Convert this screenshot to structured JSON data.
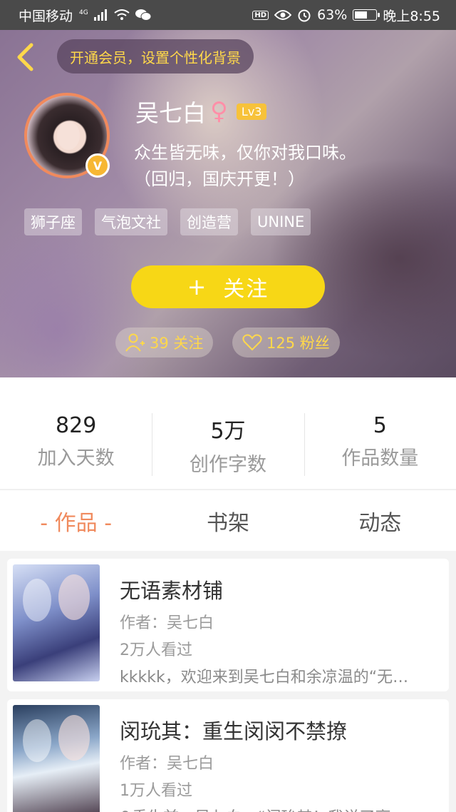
{
  "status_bar": {
    "carrier": "中国移动",
    "network": "4G",
    "battery": "63%",
    "battery_level": 0.63,
    "time": "晚上8:55"
  },
  "header": {
    "vip_prompt": "开通会员，设置个性化背景",
    "name": "吴七白",
    "gender_symbol": "♀",
    "level": "Lv3",
    "verified_badge": "V",
    "bio_line1": "众生皆无味，仅你对我口味。",
    "bio_line2": "（回归，国庆开更！）",
    "tags": [
      "狮子座",
      "气泡文社",
      "创造营",
      "UNINE"
    ],
    "follow_plus": "+",
    "follow_label": "关注",
    "following_count": "39 关注",
    "fans_count": "125 粉丝"
  },
  "stats": [
    {
      "value": "829",
      "label": "加入天数"
    },
    {
      "value": "5万",
      "label": "创作字数"
    },
    {
      "value": "5",
      "label": "作品数量"
    }
  ],
  "tabs": [
    {
      "label": "- 作品 -"
    },
    {
      "label": "书架"
    },
    {
      "label": "动态"
    }
  ],
  "books": [
    {
      "title": "无语素材铺",
      "author": "作者：吴七白",
      "views": "2万人看过",
      "desc": "kkkkk，欢迎来到吴七白和余凉温的“无…"
    },
    {
      "title": "闵玧其：重生闵闵不禁撩",
      "author": "作者：吴七白",
      "views": "1万人看过",
      "desc": "&重生前：吴七白：“闵玧其！我说了离"
    }
  ],
  "colors": {
    "accent_orange": "#f08a5d",
    "follow_yellow": "#f7d716",
    "vip_text": "#ffd84a"
  }
}
